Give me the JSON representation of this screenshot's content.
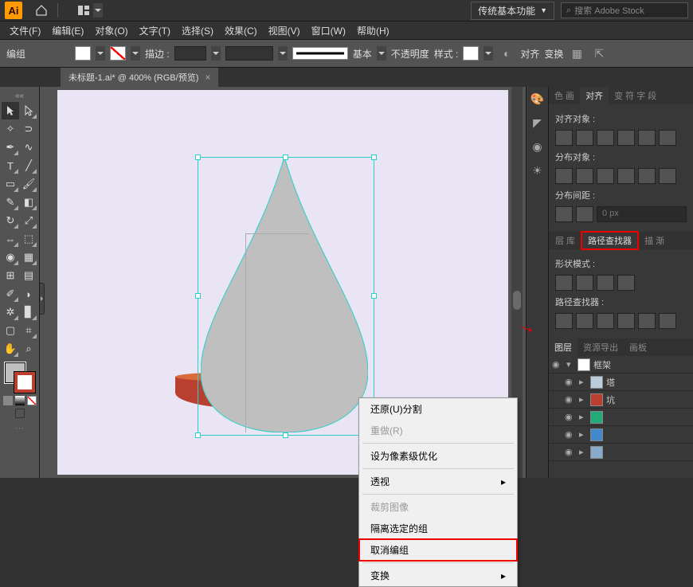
{
  "app": {
    "logo": "Ai"
  },
  "workspace": {
    "label": "传统基本功能"
  },
  "search": {
    "placeholder": "搜索 Adobe Stock"
  },
  "menu": {
    "file": "文件(F)",
    "edit": "编辑(E)",
    "object": "对象(O)",
    "type": "文字(T)",
    "select": "选择(S)",
    "effect": "效果(C)",
    "view": "视图(V)",
    "window": "窗口(W)",
    "help": "帮助(H)"
  },
  "control": {
    "selection": "编组",
    "stroke_label": "描边 :",
    "basic_label": "基本",
    "opacity_label": "不透明度",
    "style_label": "样式 :",
    "align_label": "对齐",
    "transform_label": "变换"
  },
  "doc": {
    "tab": "未标题-1.ai* @ 400% (RGB/预览)"
  },
  "context": {
    "undo": "还原(U)分割",
    "redo": "重做(R)",
    "pixel": "设为像素级优化",
    "perspective": "透视",
    "crop": "裁剪图像",
    "isolate": "隔离选定的组",
    "ungroup": "取消编组",
    "transform": "变换"
  },
  "align_panel": {
    "tabs": {
      "color": "色 画",
      "align": "对齐",
      "transform": "变 符 字 段"
    },
    "align_objects": "对齐对象 :",
    "distribute_objects": "分布对象 :",
    "distribute_spacing": "分布间距 :",
    "spacing_value": "0 px"
  },
  "pathfinder_panel": {
    "tabs": {
      "layers": "层 库",
      "pathfinder": "路径查找器",
      "other": "描 渐"
    },
    "shape_modes": "形状模式 :",
    "pathfinders": "路径查找器 :"
  },
  "layers_panel": {
    "tabs": {
      "layers": "图层",
      "assets": "资源导出",
      "artboards": "画板"
    },
    "items": [
      "框架",
      "塔",
      "坑",
      "",
      "",
      ""
    ]
  }
}
